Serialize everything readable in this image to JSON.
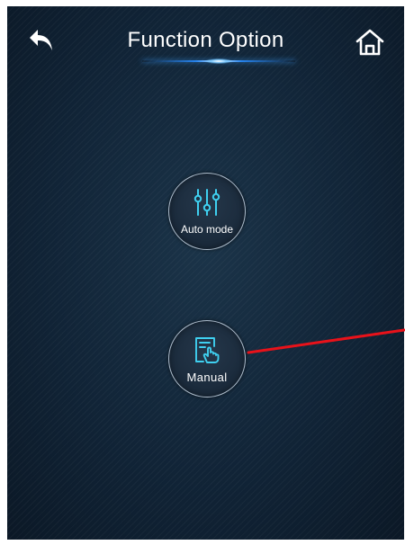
{
  "header": {
    "title": "Function Option",
    "back_icon": "back-arrow-icon",
    "home_icon": "home-icon"
  },
  "modes": [
    {
      "label": "Auto mode",
      "icon": "sliders-icon"
    },
    {
      "label": "Manual",
      "icon": "hand-touch-icon"
    }
  ],
  "colors": {
    "background": "#102030",
    "accent": "#3fd0f0",
    "title_glow": "#4aa8ff",
    "annotation": "#e8121a"
  }
}
